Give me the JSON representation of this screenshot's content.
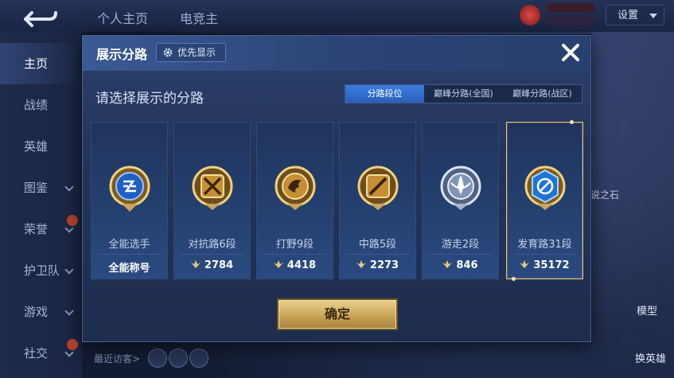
{
  "background": {
    "tabs": [
      "个人主页",
      "电竞主"
    ],
    "settings_label": "设置",
    "sidebar": [
      {
        "label": "主页",
        "active": true
      },
      {
        "label": "战绩"
      },
      {
        "label": "英雄"
      },
      {
        "label": "图鉴",
        "chevron": true
      },
      {
        "label": "荣誉",
        "chevron": true,
        "new": true
      },
      {
        "label": "护卫队",
        "chevron": true
      },
      {
        "label": "游戏",
        "chevron": true
      },
      {
        "label": "社交",
        "chevron": true,
        "new": true
      }
    ],
    "visitors_label": "最近访客>",
    "right_text": "说之石",
    "model_label": "模型",
    "swap_hero_label": "换英雄"
  },
  "modal": {
    "title": "展示分路",
    "priority_label": "优先显示",
    "prompt": "请选择展示的分路",
    "tabs": [
      {
        "label": "分路段位",
        "active": true
      },
      {
        "label": "巅峰分路(全国)"
      },
      {
        "label": "巅峰分路(战区)"
      }
    ],
    "cards": [
      {
        "name": "全能选手",
        "stat": "全能称号",
        "show_level_icon": false,
        "icon": "all-round-emblem-icon",
        "selected": false
      },
      {
        "name": "对抗路6段",
        "stat": "2784",
        "show_level_icon": true,
        "icon": "clash-lane-emblem-icon",
        "selected": false
      },
      {
        "name": "打野9段",
        "stat": "4418",
        "show_level_icon": true,
        "icon": "jungle-emblem-icon",
        "selected": false
      },
      {
        "name": "中路5段",
        "stat": "2273",
        "show_level_icon": true,
        "icon": "mid-lane-emblem-icon",
        "selected": false
      },
      {
        "name": "游走2段",
        "stat": "846",
        "show_level_icon": true,
        "icon": "roam-emblem-icon",
        "selected": false
      },
      {
        "name": "发育路31段",
        "stat": "35172",
        "show_level_icon": true,
        "icon": "farm-lane-emblem-icon",
        "selected": true
      }
    ],
    "confirm_label": "确定"
  },
  "colors": {
    "accent_blue": "#2b5fb9",
    "gold": "#c9a558",
    "selected_border": "#e9c27a"
  }
}
